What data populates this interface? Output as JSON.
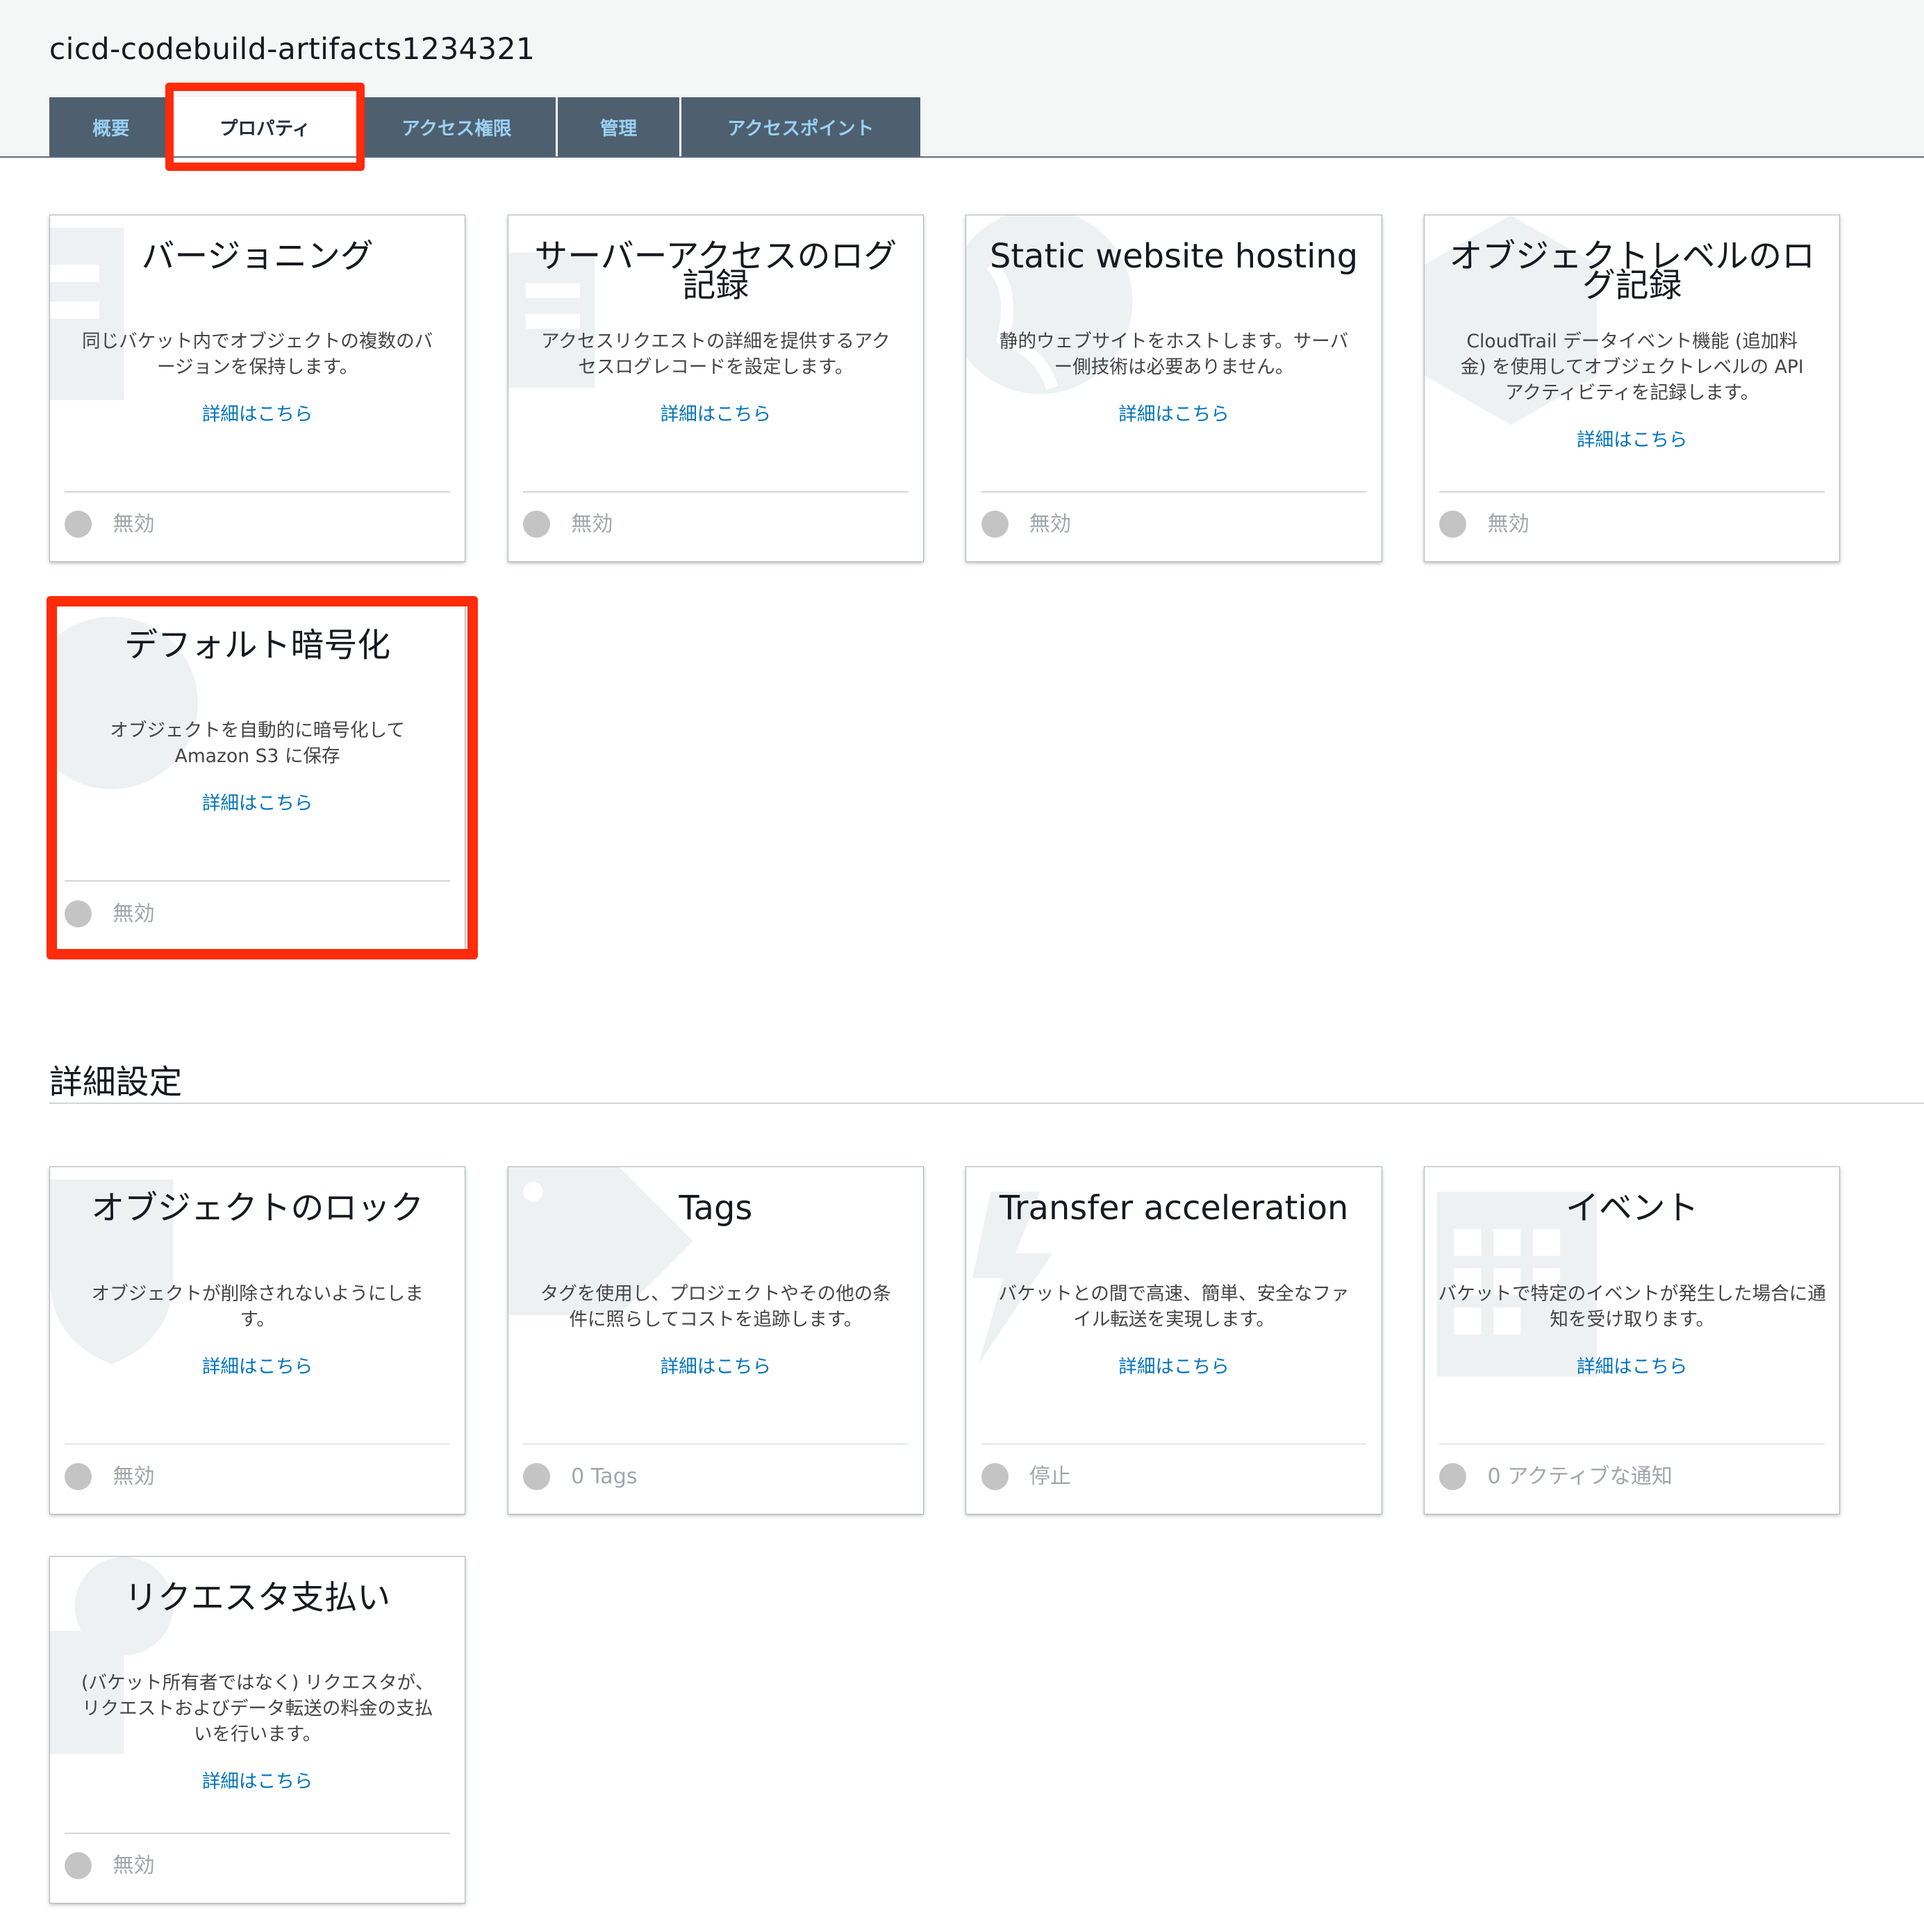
{
  "bucket_name": "cicd-codebuild-artifacts1234321",
  "tabs": [
    {
      "label": "概要"
    },
    {
      "label": "プロパティ"
    },
    {
      "label": "アクセス権限"
    },
    {
      "label": "管理"
    },
    {
      "label": "アクセスポイント"
    }
  ],
  "active_tab": "プロパティ",
  "cards": [
    {
      "title": "バージョニング",
      "desc": "同じバケット内でオブジェクトの複数のバージョンを保持します。",
      "link": "詳細はこちら",
      "status": "無効"
    },
    {
      "title": "サーバーアクセスのログ記録",
      "desc": "アクセスリクエストの詳細を提供するアクセスログレコードを設定します。",
      "link": "詳細はこちら",
      "status": "無効"
    },
    {
      "title": "Static website hosting",
      "desc": "静的ウェブサイトをホストします。サーバー側技術は必要ありません。",
      "link": "詳細はこちら",
      "status": "無効"
    },
    {
      "title": "オブジェクトレベルのログ記録",
      "desc": "CloudTrail データイベント機能 (追加料金) を使用してオブジェクトレベルの API アクティビティを記録します。",
      "link": "詳細はこちら",
      "status": "無効"
    },
    {
      "title": "デフォルト暗号化",
      "desc": "オブジェクトを自動的に暗号化して Amazon S3 に保存",
      "link": "詳細はこちら",
      "status": "無効"
    }
  ],
  "advanced_section_title": "詳細設定",
  "advanced_cards": [
    {
      "title": "オブジェクトのロック",
      "desc": "オブジェクトが削除されないようにします。",
      "link": "詳細はこちら",
      "status": "無効"
    },
    {
      "title": "Tags",
      "desc": "タグを使用し、プロジェクトやその他の条件に照らしてコストを追跡します。",
      "link": "詳細はこちら",
      "status": "0 Tags"
    },
    {
      "title": "Transfer acceleration",
      "desc": "バケットとの間で高速、簡単、安全なファイル転送を実現します。",
      "link": "詳細はこちら",
      "status": "停止"
    },
    {
      "title": "イベント",
      "desc": "バケットで特定のイベントが発生した場合に通知を受け取ります。",
      "link": "詳細はこちら",
      "status": "0 アクティブな通知"
    },
    {
      "title": "リクエスタ支払い",
      "desc": "(バケット所有者ではなく) リクエスタが、リクエストおよびデータ転送の料金の支払いを行います。",
      "link": "詳細はこちら",
      "status": "無効"
    }
  ],
  "colors": {
    "tab_bg": "#4e606f",
    "tab_text": "#9ad0f5",
    "link": "#0073bb",
    "highlight": "#ff2b0a",
    "status_dot": "#c4c4c4"
  }
}
